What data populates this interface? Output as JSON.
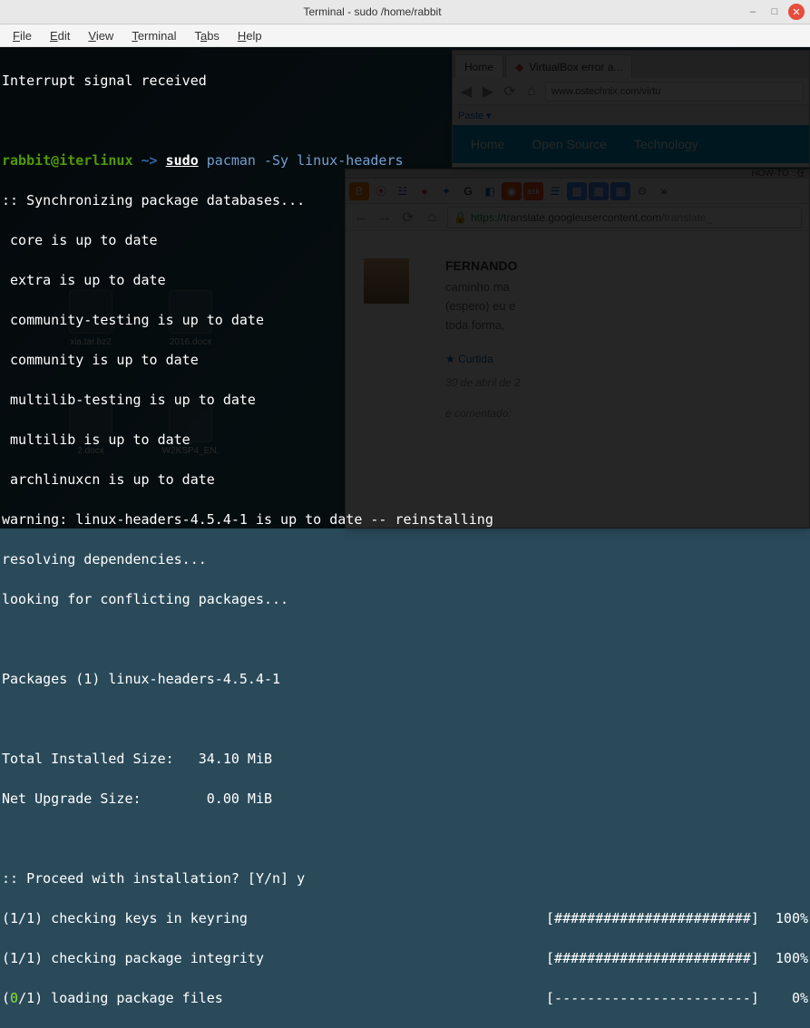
{
  "window": {
    "title": "Terminal - sudo  /home/rabbit"
  },
  "menubar": {
    "file": "File",
    "edit": "Edit",
    "view": "View",
    "terminal": "Terminal",
    "tabs": "Tabs",
    "help": "Help"
  },
  "terminal": {
    "line_interrupt": "Interrupt signal received",
    "prompt_user": "rabbit@iterlinux",
    "prompt_arrow": " ~> ",
    "cmd_sudo": "sudo",
    "cmd_rest": " pacman -Sy linux-headers",
    "sync": ":: Synchronizing package databases...",
    "core": " core is up to date",
    "extra": " extra is up to date",
    "ct": " community-testing is up to date",
    "comm": " community is up to date",
    "mt": " multilib-testing is up to date",
    "ml": " multilib is up to date",
    "arch": " archlinuxcn is up to date",
    "warn": "warning: linux-headers-4.5.4-1 is up to date -- reinstalling",
    "resolv": "resolving dependencies...",
    "conflict": "looking for conflicting packages...",
    "pkgs": "Packages (1) linux-headers-4.5.4-1",
    "tsize": "Total Installed Size:   34.10 MiB",
    "nsize": "Net Upgrade Size:        0.00 MiB",
    "proceed_q": ":: Proceed with installation? [Y/n] ",
    "proceed_a": "y",
    "keys": "(1/1) checking keys in keyring",
    "integ": "(1/1) checking package integrity",
    "load_p1": "(",
    "load_p2": "0",
    "load_p3": "/1) loading package files",
    "bar100": "[########################]  100%",
    "bar0": "[------------------------]    0%"
  },
  "firefox": {
    "tab1": "Home",
    "tab2": "VirtualBox error a...",
    "paste": "Paste ▾",
    "url": "www.ostechnix.com/virtu",
    "nav1": "Home",
    "nav2": "Open Source",
    "nav3": "Technology"
  },
  "chromium": {
    "top": "HOW-TO ::在",
    "url_https": "https://",
    "url_host": "translate.googleusercontent.com",
    "url_path": "/translate_",
    "name": "FERNANDO",
    "t1": "caminho ma",
    "t2": "(espero) eu e",
    "t3": "toda forma,",
    "like": "Curtida",
    "date": "30 de abril de 2",
    "resp": "e comentado:"
  },
  "desktop": {
    "i1": "xia.tar.bz2",
    "i2": "2016.docx",
    "i3": "2.docx",
    "i4": "W2KSP4_EN."
  }
}
